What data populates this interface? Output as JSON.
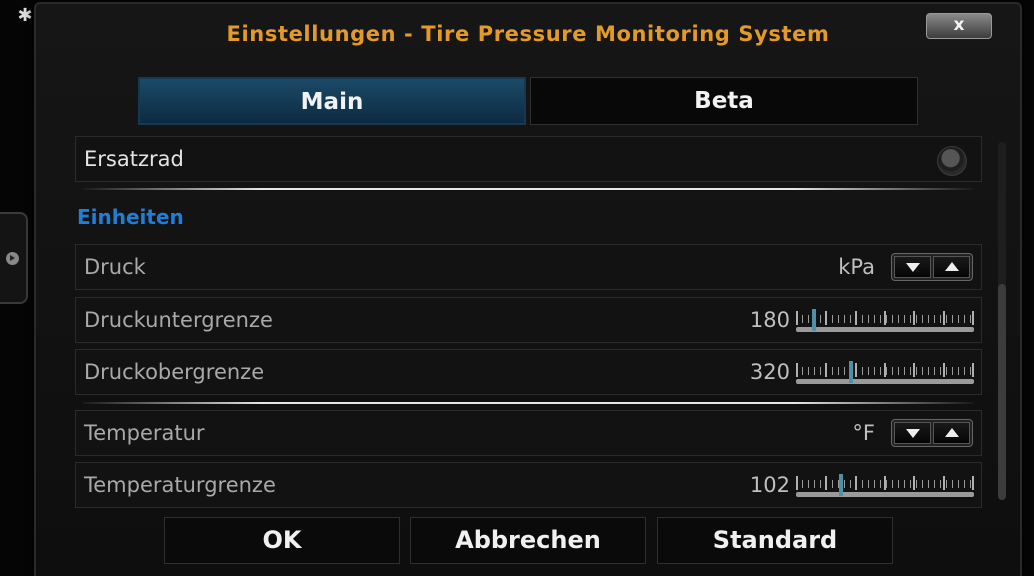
{
  "window": {
    "title": "Einstellungen - Tire Pressure Monitoring System",
    "close_label": "x"
  },
  "tabs": [
    {
      "label": "Main",
      "active": true
    },
    {
      "label": "Beta",
      "active": false
    }
  ],
  "settings": {
    "ersatzrad": {
      "label": "Ersatzrad",
      "enabled": false
    },
    "section_units": "Einheiten",
    "druck": {
      "label": "Druck",
      "value": "kPa"
    },
    "druckuntergrenze": {
      "label": "Druckuntergrenze",
      "value": "180",
      "level": 0.1
    },
    "druckobergrenze": {
      "label": "Druckobergrenze",
      "value": "320",
      "level": 0.31
    },
    "temperatur": {
      "label": "Temperatur",
      "value": "°F"
    },
    "temperaturgrenze": {
      "label": "Temperaturgrenze",
      "value": "102",
      "level": 0.25
    }
  },
  "buttons": {
    "ok": "OK",
    "cancel": "Abbrechen",
    "default": "Standard"
  },
  "colors": {
    "title": "#e39a2b",
    "section_header": "#1e7ed8",
    "active_tab": "#1b4a68",
    "slider_thumb": "#4f8fa8"
  },
  "icons": [
    "gear-icon",
    "chevron-right-icon",
    "close-icon",
    "toggle-icon",
    "arrow-down-icon",
    "arrow-up-icon"
  ]
}
